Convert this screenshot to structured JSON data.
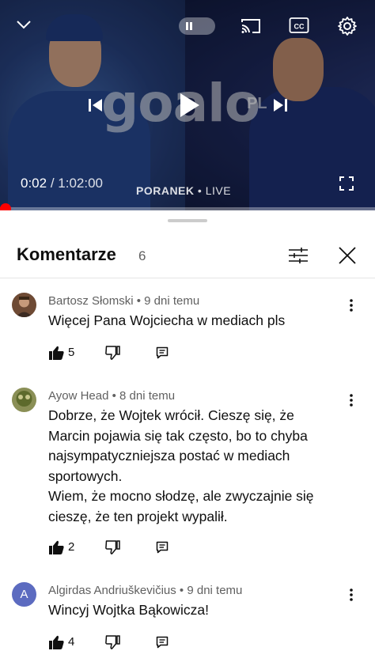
{
  "player": {
    "current_time": "0:02",
    "separator": " / ",
    "duration": "1:02:00",
    "show_name": "PORANEK",
    "live_separator": " • ",
    "live_label": "LIVE",
    "logo_text": "goalo",
    "logo_suffix": "PL",
    "progress_fraction": 0.0005,
    "icons": [
      "chevron-down-icon",
      "pause-icon",
      "cast-icon",
      "captions-icon",
      "settings-gear-icon",
      "previous-icon",
      "play-icon",
      "next-icon",
      "fullscreen-icon"
    ]
  },
  "comments_panel": {
    "title": "Komentarze",
    "count": "6",
    "icons": [
      "filter-icon",
      "close-icon"
    ]
  },
  "comments": [
    {
      "author": "Bartosz Słomski",
      "time": "9 dni temu",
      "text": "Więcej Pana Wojciecha w mediach pls",
      "likes": "5",
      "avatar_color": "#8a5a3c"
    },
    {
      "author": "Ayow Head",
      "time": "8 dni temu",
      "text": "Dobrze, że Wojtek wrócił. Cieszę się, że Marcin pojawia się tak często, bo to chyba najsympatyczniejsza postać w mediach sportowych.\nWiem, że mocno słodzę, ale zwyczajnie się cieszę, że ten projekt wypalił.",
      "likes": "2",
      "avatar_color": "#6b7a3a"
    },
    {
      "author": "Algirdas Andriuškevičius",
      "time": "9 dni temu",
      "text": "Wincyj Wojtka Bąkowicza!",
      "likes": "4",
      "avatar_letter": "A",
      "avatar_color": "#5c6bc0"
    }
  ],
  "colors": {
    "accent_red": "#ff0000",
    "text_primary": "#0f0f0f",
    "text_secondary": "#606060"
  }
}
